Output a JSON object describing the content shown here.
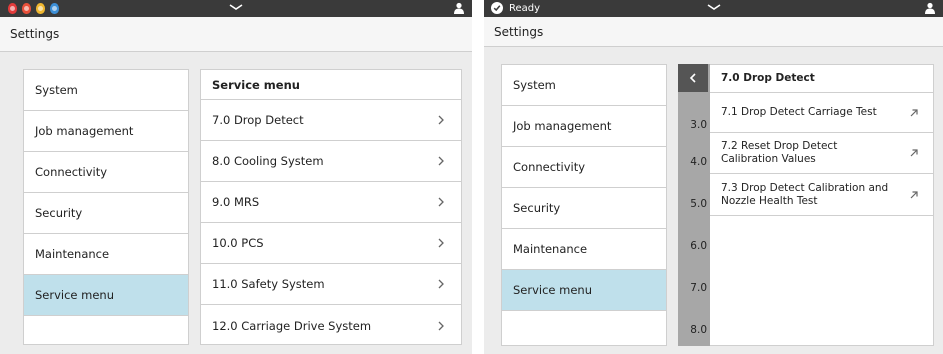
{
  "left_screen": {
    "title": "Settings",
    "sidebar": [
      {
        "label": "System"
      },
      {
        "label": "Job management"
      },
      {
        "label": "Connectivity"
      },
      {
        "label": "Security"
      },
      {
        "label": "Maintenance"
      },
      {
        "label": "Service menu",
        "selected": true
      }
    ],
    "content": {
      "header": "Service menu",
      "items": [
        {
          "label": "7.0 Drop Detect"
        },
        {
          "label": "8.0 Cooling System"
        },
        {
          "label": "9.0 MRS"
        },
        {
          "label": "10.0 PCS"
        },
        {
          "label": "11.0 Safety System"
        },
        {
          "label": "12.0 Carriage Drive System"
        }
      ]
    },
    "ink_colors": [
      "#e33b3b",
      "#e8503a",
      "#f0b72f",
      "#3d8fd6"
    ]
  },
  "right_screen": {
    "status": "Ready",
    "title": "Settings",
    "sidebar": [
      {
        "label": "System"
      },
      {
        "label": "Job management"
      },
      {
        "label": "Connectivity"
      },
      {
        "label": "Security"
      },
      {
        "label": "Maintenance"
      },
      {
        "label": "Service menu",
        "selected": true
      }
    ],
    "strip_labels": [
      "3.0",
      "4.0",
      "5.0",
      "6.0",
      "7.0",
      "8.0"
    ],
    "detail": {
      "header": "7.0 Drop Detect",
      "items": [
        {
          "label": "7.1 Drop Detect Carriage Test"
        },
        {
          "label": "7.2 Reset Drop Detect Calibration Values"
        },
        {
          "label": "7.3 Drop Detect Calibration and Nozzle Health Test"
        }
      ]
    }
  },
  "colors": {
    "selected_bg": "#bfe0eb",
    "status_bar": "#3a3a3a",
    "strip_gray": "#a7a7a7"
  }
}
